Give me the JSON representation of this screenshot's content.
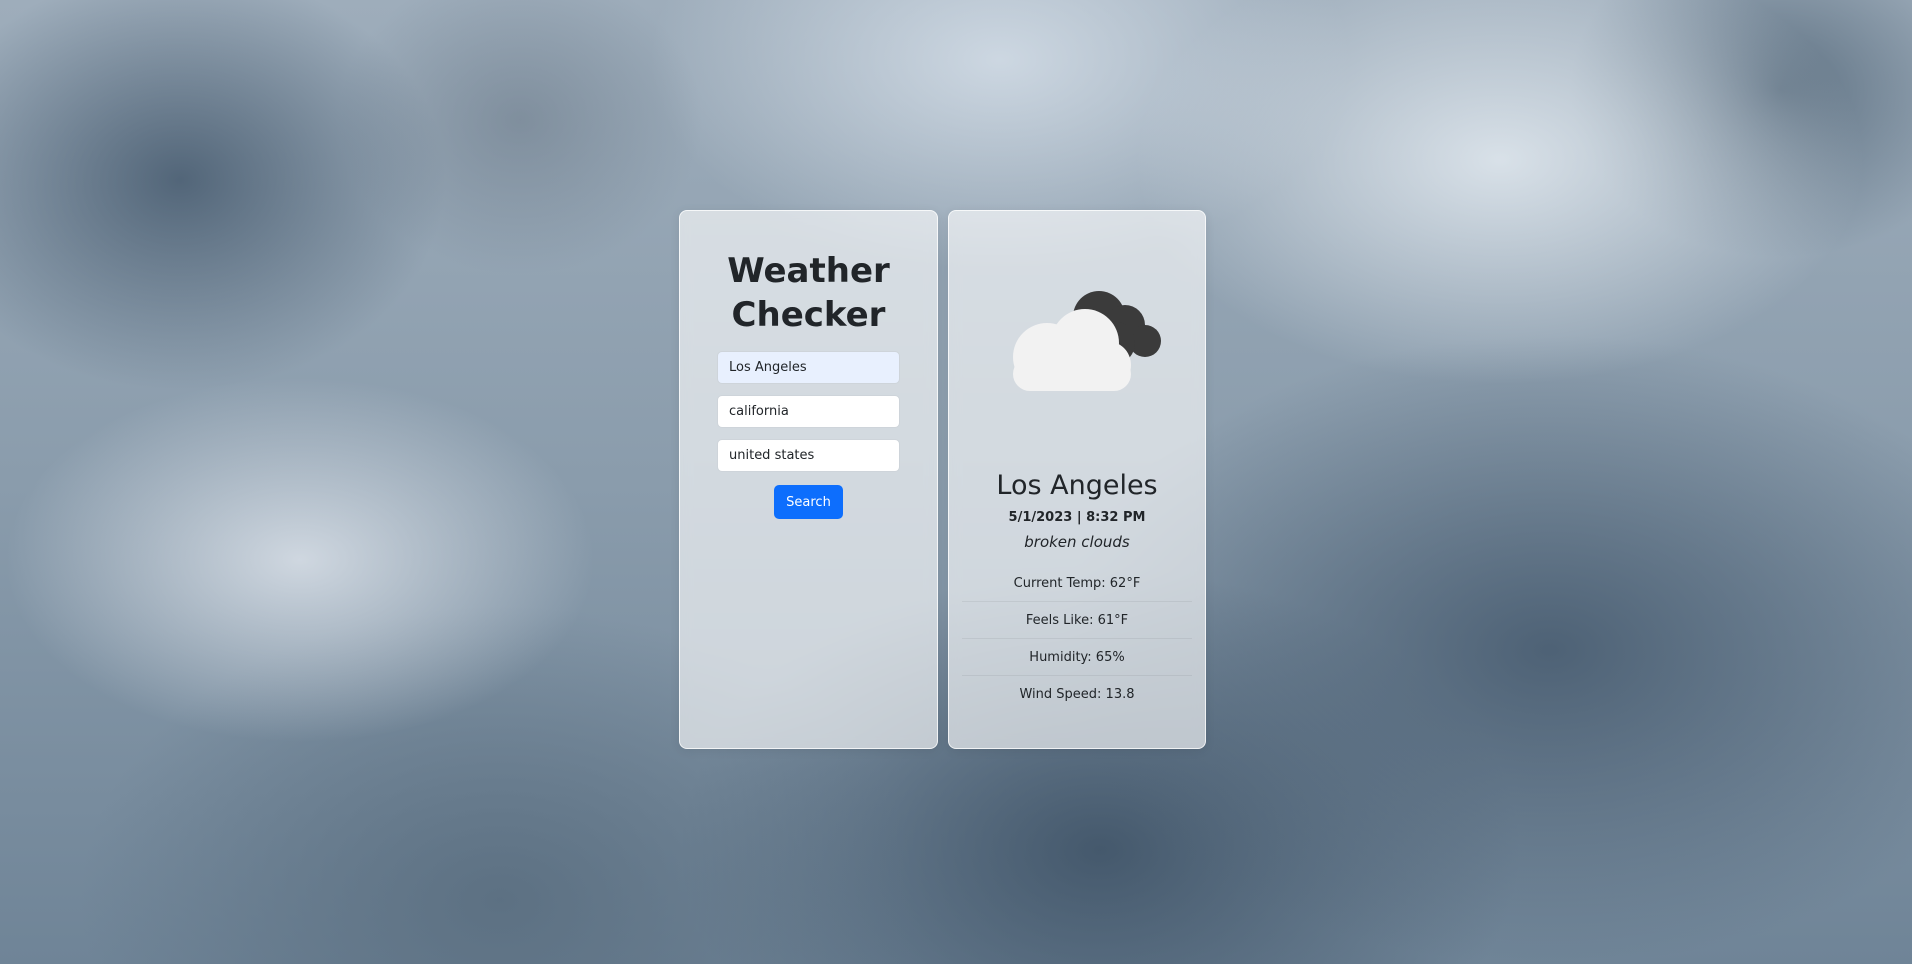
{
  "app": {
    "title": "Weather Checker"
  },
  "search": {
    "city_value": "Los Angeles",
    "state_value": "california",
    "country_value": "united states",
    "button_label": "Search"
  },
  "weather": {
    "icon": "broken-clouds-icon",
    "city": "Los Angeles",
    "datetime": "5/1/2023 | 8:32 PM",
    "description": "broken clouds",
    "stats": [
      "Current Temp: 62°F",
      "Feels Like: 61°F",
      "Humidity: 65%",
      "Wind Speed: 13.8"
    ]
  },
  "colors": {
    "accent": "#0d6efd",
    "text": "#212529"
  }
}
